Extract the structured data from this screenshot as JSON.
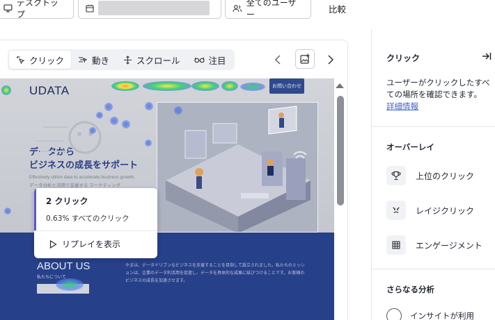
{
  "toolbar": {
    "device_label": "デスクトップ",
    "users_label": "全てのユーザー",
    "compare_label": "比較"
  },
  "tabs": [
    {
      "label": "クリック",
      "icon": "click-icon",
      "active": true
    },
    {
      "label": "動き",
      "icon": "movement-icon",
      "active": false
    },
    {
      "label": "スクロール",
      "icon": "scroll-icon",
      "active": false
    },
    {
      "label": "注目",
      "icon": "glasses-icon",
      "active": false
    }
  ],
  "site": {
    "logo": "UDATA",
    "cta": "お問い合わせ",
    "headline_line1": "データから",
    "headline_line2": "ビジネスの成長をサポート",
    "sub_line1": "Effectively utilize data to accelerate business growth.",
    "sub_line2": "データ分析と活用で支援する マーケティング",
    "about_title": "ABOUT US",
    "about_sub": "私たちについて",
    "about_text": "やまは、データドリブンなビジネスを支援することを目指して設立されました。私たちのミッションは、企業のデータ利活用を促進し、データを具体的な成果に結びつけることです。お客様のビジネスの成長を加速させます。"
  },
  "tooltip": {
    "title": "2 クリック",
    "percent": "0.63% すべてのクリック",
    "replay": "リプレイを表示"
  },
  "right_panel": {
    "title": "クリック",
    "description": "ユーザーがクリックしたすべての場所を確認できます。",
    "detail_link": "詳細情報",
    "overlay_heading": "オーバーレイ",
    "overlay_items": [
      {
        "label": "上位のクリック",
        "icon": "trophy-icon"
      },
      {
        "label": "レイジクリック",
        "icon": "angry-face-icon"
      },
      {
        "label": "エンゲージメント",
        "icon": "grid-icon"
      }
    ],
    "analysis_heading": "さらなる分析",
    "insight_label": "インサイトが利用"
  },
  "colors": {
    "accent": "#5b57d6",
    "link": "#3d5fc8",
    "site_blue": "#27408a"
  }
}
